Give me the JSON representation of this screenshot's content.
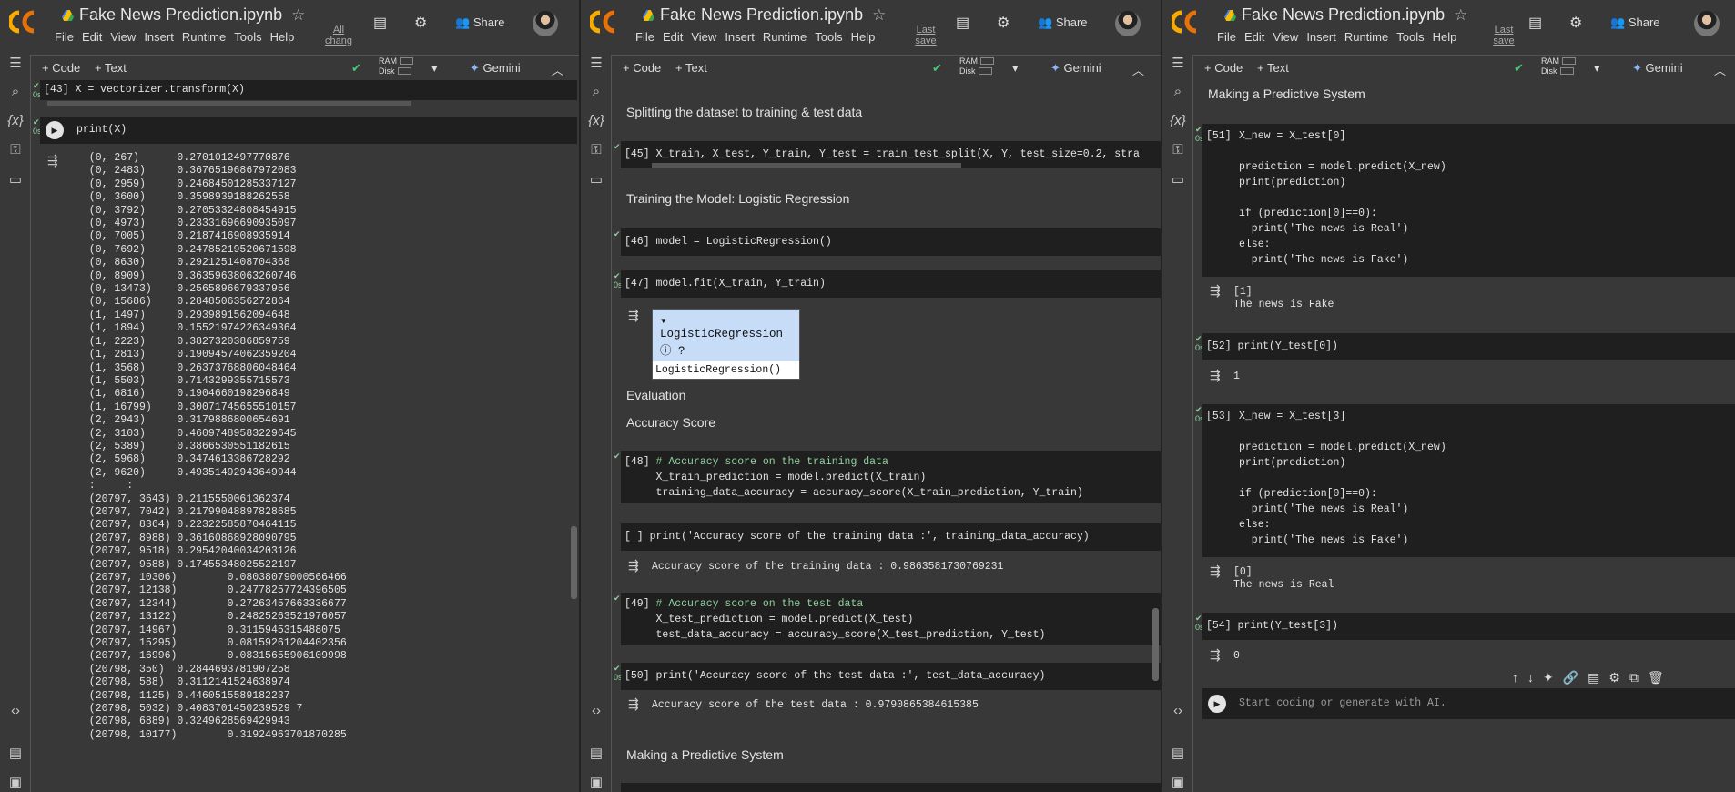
{
  "app": {
    "title": "Fake News Prediction.ipynb",
    "menu": [
      "File",
      "Edit",
      "View",
      "Insert",
      "Runtime",
      "Tools",
      "Help"
    ],
    "share": "Share",
    "code_btn": "+ Code",
    "text_btn": "+ Text",
    "ram": "RAM",
    "disk": "Disk",
    "gemini": "Gemini",
    "saved_p1": "All chang",
    "saved_p2": "Last save",
    "saved_p3": "Last save",
    "time": "0s"
  },
  "pane1": {
    "cell43": {
      "prompt": "[43]",
      "code": "X = vectorizer.transform(X)"
    },
    "cell44": {
      "code": "print(X)"
    },
    "output": "  (0, 267)\t0.2701012497770876\n  (0, 2483)\t0.36765196867972083\n  (0, 2959)\t0.24684501285337127\n  (0, 3600)\t0.3598939188262558\n  (0, 3792)\t0.27053324808454915\n  (0, 4973)\t0.23331696690935097\n  (0, 7005)\t0.2187416908935914\n  (0, 7692)\t0.24785219520671598\n  (0, 8630)\t0.2921251408704368\n  (0, 8909)\t0.36359638063260746\n  (0, 13473)\t0.2565896679337956\n  (0, 15686)\t0.2848506356272864\n  (1, 1497)\t0.2939891562094648\n  (1, 1894)\t0.15521974226349364\n  (1, 2223)\t0.3827320386859759\n  (1, 2813)\t0.19094574062359204\n  (1, 3568)\t0.26373768806048464\n  (1, 5503)\t0.7143299355715573\n  (1, 6816)\t0.1904660198296849\n  (1, 16799)\t0.30071745655510157\n  (2, 2943)\t0.3179886800654691\n  (2, 3103)\t0.46097489583229645\n  (2, 5389)\t0.3866530551182615\n  (2, 5968)\t0.3474613386728292\n  (2, 9620)\t0.49351492943649944\n  :\t:\n  (20797, 3643)\t0.2115550061362374\n  (20797, 7042)\t0.21799048897828685\n  (20797, 8364)\t0.22322585870464115\n  (20797, 8988)\t0.36160868928090795\n  (20797, 9518)\t0.29542040034203126\n  (20797, 9588)\t0.17455348025522197\n  (20797, 10306)\t0.08038079000566466\n  (20797, 12138)\t0.24778257724396505\n  (20797, 12344)\t0.27263457663336677\n  (20797, 13122)\t0.24825263521976057\n  (20797, 14967)\t0.3115945315488075\n  (20797, 15295)\t0.08159261204402356\n  (20797, 16996)\t0.08315655906109998\n  (20798, 350)\t0.2844693781907258\n  (20798, 588)\t0.3112141524638974\n  (20798, 1125)\t0.4460515589182237\n  (20798, 5032)\t0.4083701450239529 7\n  (20798, 6889)\t0.3249628569429943\n  (20798, 10177)\t0.31924963701870285"
  },
  "pane2": {
    "h_split": "Splitting the dataset to training & test data",
    "c45": {
      "prompt": "[45]",
      "code": "X_train, X_test, Y_train, Y_test = train_test_split(X, Y, test_size=0.2, stra"
    },
    "h_train": "Training the Model: Logistic Regression",
    "c46": {
      "prompt": "[46]",
      "code": "model = LogisticRegression()"
    },
    "c47": {
      "prompt": "[47]",
      "code": "model.fit(X_train, Y_train)"
    },
    "lr_head": "LogisticRegression",
    "lr_body": "LogisticRegression()",
    "h_eval": "Evaluation",
    "h_acc": "Accuracy Score",
    "c48": {
      "prompt": "[48]",
      "l1": "# Accuracy score on the training data",
      "l2": "X_train_prediction = model.predict(X_train)",
      "l3": "training_data_accuracy = accuracy_score(X_train_prediction, Y_train)"
    },
    "cpr": {
      "prompt": "[ ]",
      "code": "print('Accuracy score of the training data :', training_data_accuracy)"
    },
    "out_train": "Accuracy score of the training data : 0.9863581730769231",
    "c49": {
      "prompt": "[49]",
      "l1": "# Accuracy score on the test data",
      "l2": "X_test_prediction = model.predict(X_test)",
      "l3": "test_data_accuracy = accuracy_score(X_test_prediction, Y_test)"
    },
    "c50": {
      "prompt": "[50]",
      "code": "print('Accuracy score of the test data :', test_data_accuracy)"
    },
    "out_test": "Accuracy score of the test data : 0.9790865384615385",
    "h_pred": "Making a Predictive System"
  },
  "pane3": {
    "h_pred": "Making a Predictive System",
    "c51": {
      "prompt": "[51]",
      "code": "X_new = X_test[0]\n\nprediction = model.predict(X_new)\nprint(prediction)\n\nif (prediction[0]==0):\n  print('The news is Real')\nelse:\n  print('The news is Fake')"
    },
    "o51": "[1]\nThe news is Fake",
    "c52": {
      "prompt": "[52]",
      "code": "print(Y_test[0])"
    },
    "o52": "1",
    "c53": {
      "prompt": "[53]",
      "code": "X_new = X_test[3]\n\nprediction = model.predict(X_new)\nprint(prediction)\n\nif (prediction[0]==0):\n  print('The news is Real')\nelse:\n  print('The news is Fake')"
    },
    "o53": "[0]\nThe news is Real",
    "c54": {
      "prompt": "[54]",
      "code": "print(Y_test[3])"
    },
    "o54": "0",
    "new_placeholder": "Start coding or generate with AI."
  }
}
